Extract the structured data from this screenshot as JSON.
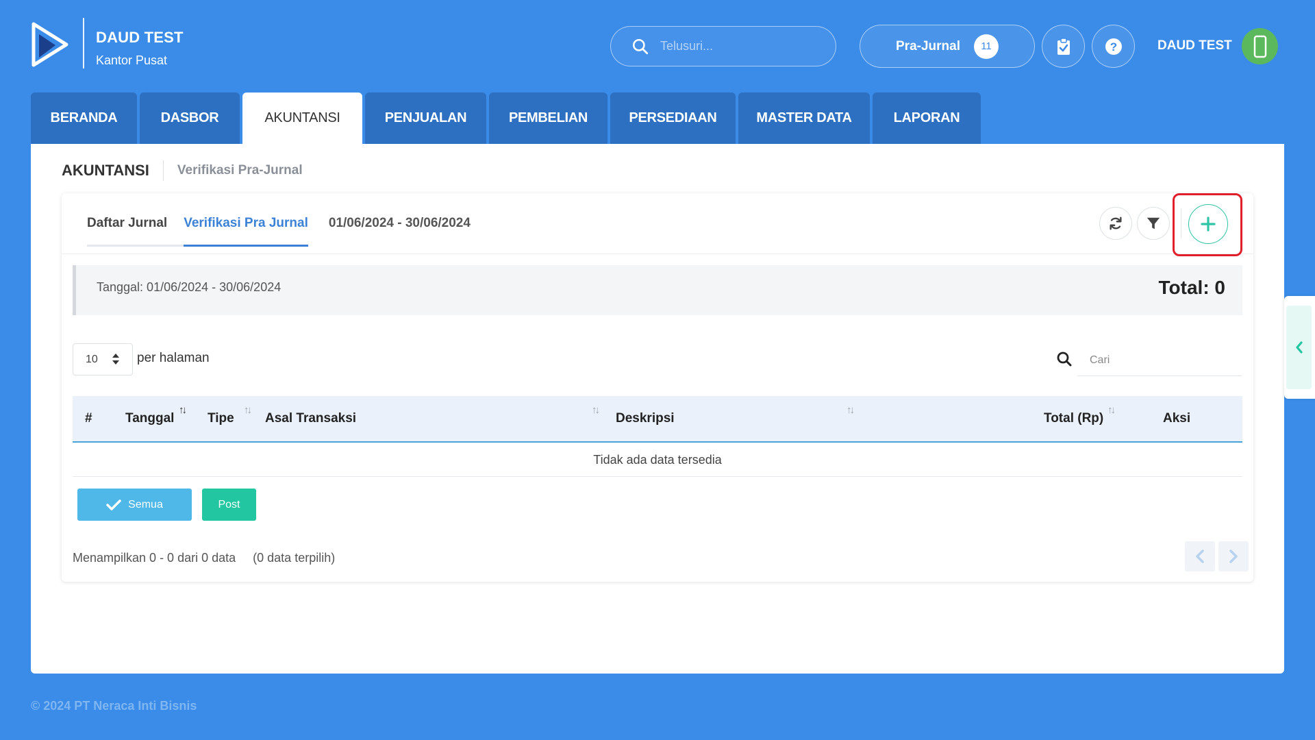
{
  "header": {
    "company_name": "DAUD TEST",
    "branch": "Kantor Pusat",
    "search_placeholder": "Telusuri...",
    "prajurnal_label": "Pra-Jurnal",
    "prajurnal_count": "11",
    "user_name": "DAUD TEST"
  },
  "nav": {
    "tabs": [
      "BERANDA",
      "DASBOR",
      "AKUNTANSI",
      "PENJUALAN",
      "PEMBELIAN",
      "PERSEDIAAN",
      "MASTER DATA",
      "LAPORAN"
    ],
    "active": "AKUNTANSI"
  },
  "breadcrumb": {
    "main": "AKUNTANSI",
    "sub": "Verifikasi Pra-Jurnal"
  },
  "subtabs": {
    "daftar": "Daftar Jurnal",
    "verifikasi": "Verifikasi Pra Jurnal",
    "date_range": "01/06/2024 - 30/06/2024"
  },
  "filter": {
    "label": "Tanggal: 01/06/2024 - 30/06/2024",
    "total": "Total: 0"
  },
  "table_controls": {
    "per_page_value": "10",
    "per_page_label": "per halaman",
    "search_placeholder": "Cari"
  },
  "table": {
    "columns": [
      "#",
      "Tanggal",
      "Tipe",
      "Asal Transaksi",
      "Deskripsi",
      "Total (Rp)",
      "Aksi"
    ],
    "empty_text": "Tidak ada data tersedia"
  },
  "actions": {
    "semua": "Semua",
    "post": "Post"
  },
  "footer": {
    "showing": "Menampilkan 0 - 0 dari 0 data",
    "selected": "(0 data terpilih)"
  },
  "copyright": "© 2024 PT Neraca Inti Bisnis",
  "colors": {
    "background": "#3b8be8",
    "nav_tab": "#2d6fc0",
    "accent_teal": "#22c6a0",
    "accent_blue": "#3b82d6",
    "highlight_red": "#e01f2a"
  }
}
